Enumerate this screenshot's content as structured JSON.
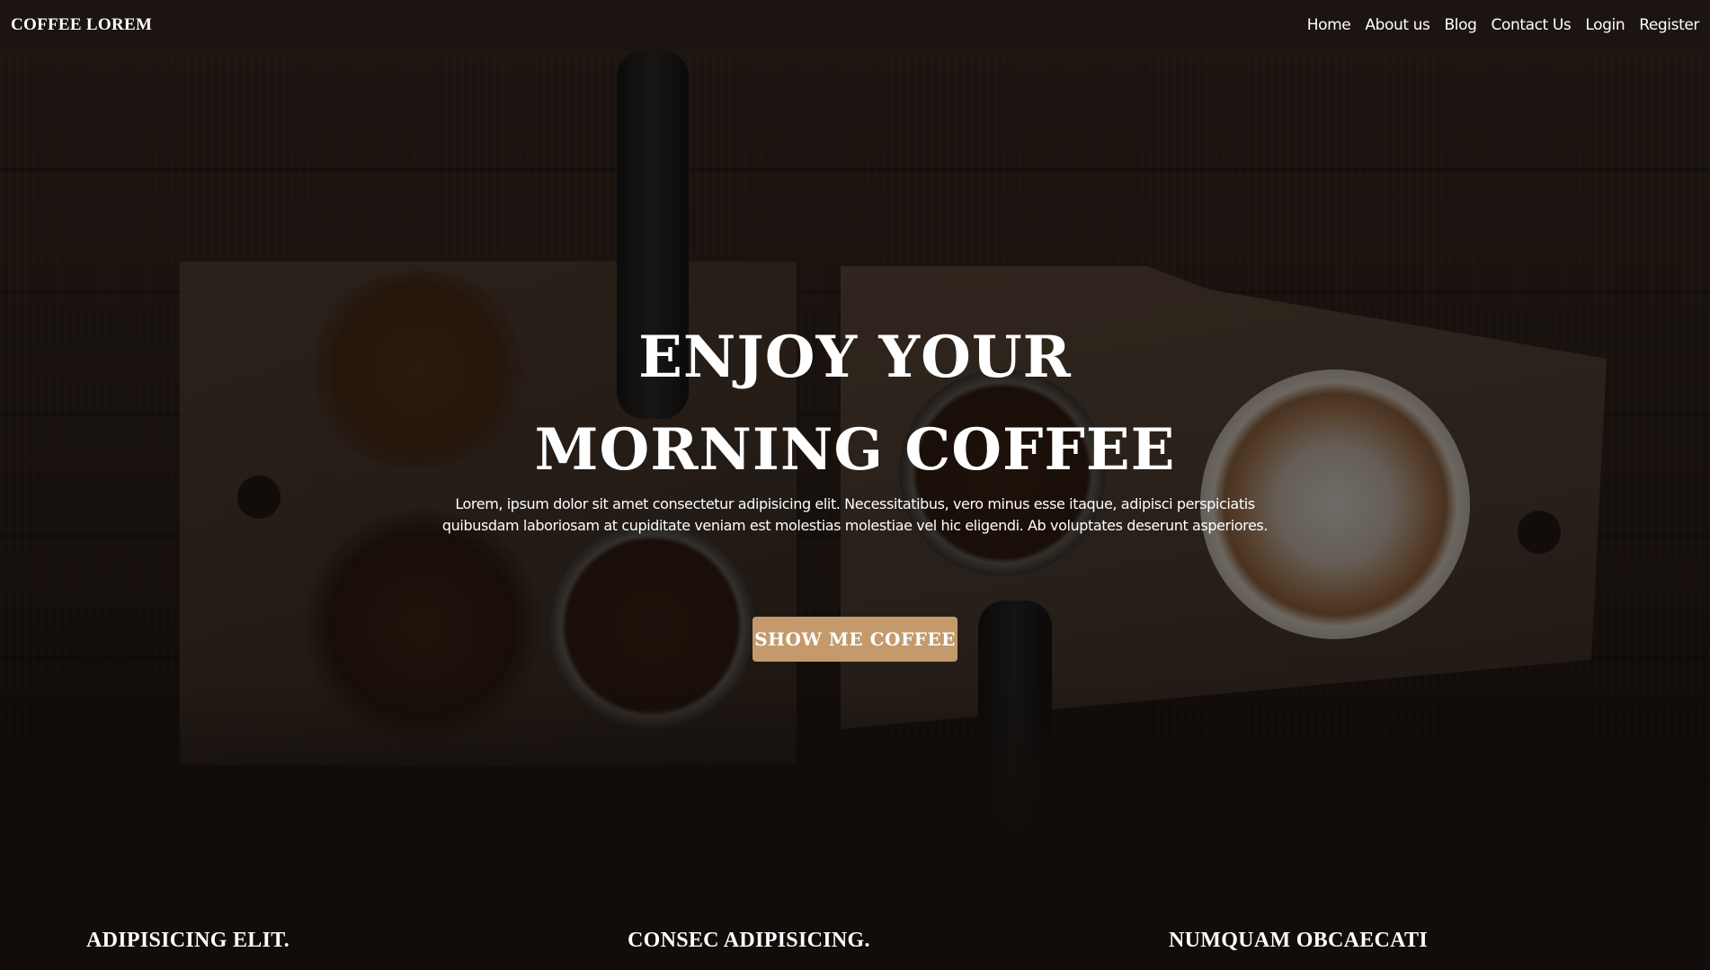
{
  "navbar": {
    "brand": "COFFEE LOREM",
    "links": [
      "Home",
      "About us",
      "Blog",
      "Contact Us",
      "Login",
      "Register"
    ]
  },
  "hero": {
    "title_line1": "ENJOY YOUR",
    "title_line2": "MORNING COFFEE",
    "description": "Lorem, ipsum dolor sit amet consectetur adipisicing elit. Necessitatibus, vero minus esse itaque, adipisci perspiciatis quibusdam laboriosam at cupiditate veniam est molestias molestiae vel hic eligendi. Ab voluptates deserunt asperiores.",
    "cta_label": "SHOW ME COFFEE"
  },
  "features": {
    "items": [
      "ADIPISICING ELIT.",
      "CONSEC ADIPISICING.",
      "NUMQUAM OBCAECATI"
    ]
  },
  "colors": {
    "navbar_bg": "#1b1412",
    "accent": "#c49a6c",
    "page_bg": "#120d0b"
  }
}
